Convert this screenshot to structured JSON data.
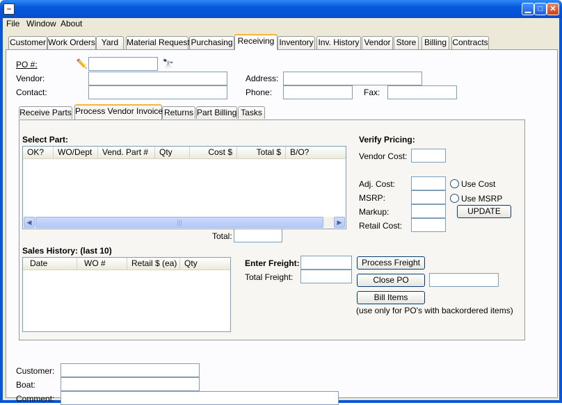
{
  "window": {
    "icon_text": "▭"
  },
  "menubar": {
    "items": [
      "File",
      "Window",
      "About"
    ]
  },
  "main_tabs": [
    "Customer",
    "Work Orders",
    "Yard",
    "Material Request",
    "Purchasing",
    "Receiving",
    "Inventory",
    "Inv. History",
    "Vendor",
    "Store",
    "Billing",
    "Contracts"
  ],
  "active_main_tab": "Receiving",
  "header": {
    "po_label": "PO #:",
    "po_value": "",
    "vendor_label": "Vendor:",
    "vendor_value": "",
    "contact_label": "Contact:",
    "contact_value": "",
    "address_label": "Address:",
    "address_value": "",
    "phone_label": "Phone:",
    "phone_value": "",
    "fax_label": "Fax:",
    "fax_value": ""
  },
  "sub_tabs": [
    "Receive Parts",
    "Process Vendor Invoice",
    "Returns",
    "Part Billing",
    "Tasks"
  ],
  "active_sub_tab": "Process Vendor Invoice",
  "select_part": {
    "title": "Select Part:",
    "columns": [
      "OK?",
      "WO/Dept",
      "Vend. Part #",
      "Qty",
      "Cost $",
      "Total $",
      "B/O?"
    ],
    "rows": [],
    "scroll_thumb_glyph": "|||",
    "total_label": "Total:",
    "total_value": ""
  },
  "sales_history": {
    "title": "Sales History: (last 10)",
    "columns": [
      "Date",
      "WO #",
      "Retail $ (ea)",
      "Qty"
    ],
    "rows": []
  },
  "verify_pricing": {
    "title": "Verify Pricing:",
    "vendor_cost_label": "Vendor Cost:",
    "adj_cost_label": "Adj. Cost:",
    "msrp_label": "MSRP:",
    "markup_label": "Markup:",
    "retail_cost_label": "Retail Cost:",
    "use_cost_label": "Use Cost",
    "use_msrp_label": "Use MSRP",
    "update_label": "UPDATE"
  },
  "freight": {
    "enter_label": "Enter Freight:",
    "total_label": "Total Freight:",
    "process_button": "Process Freight",
    "close_po_button": "Close PO",
    "bill_items_button": "Bill Items",
    "bill_note": "(use only for PO's with backordered items)"
  },
  "footer": {
    "customer_label": "Customer:",
    "boat_label": "Boat:",
    "comment_label": "Comment:"
  },
  "colors": {
    "titlebar": "#0553d6",
    "tab_highlight": "#f8b43a",
    "window_bg": "#ece9d8"
  }
}
